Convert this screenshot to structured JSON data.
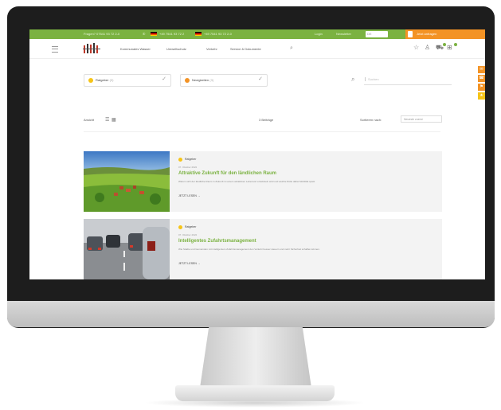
{
  "topbar": {
    "contact": "Fragen? 07541 93 72 2-0",
    "phone_de": "+49 7541 93 72 2",
    "phone_alt": "+49 7541 93 72 2-0",
    "link1": "Login",
    "link2": "Newsletter",
    "box_label": "DE",
    "orange_label": "Jetzt anfragen"
  },
  "nav": {
    "items": [
      "Kommunales Wasser",
      "Umweltschutz",
      "Verkehr",
      "Service & Dokumente"
    ],
    "icons": [
      "star-icon",
      "user-icon",
      "cart-icon",
      "bag-icon"
    ]
  },
  "filters": [
    {
      "label": "Ratgeber",
      "count": "(3)",
      "color": "#f6c417"
    },
    {
      "label": "Neuigkeiten",
      "count": "(3)",
      "color": "#f39325"
    }
  ],
  "search": {
    "placeholder": "Suchen"
  },
  "view": {
    "label": "Ansicht",
    "results": "3 Beiträge",
    "sort_label": "Sortieren nach:",
    "sort_value": "Neueste zuerst"
  },
  "articles": [
    {
      "category": "Ratgeber",
      "date": "07. Oktober 2022",
      "title": "Attraktive Zukunft für den ländlichen Raum",
      "description": "Warum sich der ländliche Raum in Zukunft zu einem attraktiven Lebensort entwickeln wird und welche Rolle dabei Mobilität spielt.",
      "more": "JETZT LESEN"
    },
    {
      "category": "Ratgeber",
      "date": "07. Oktober 2022",
      "title": "Intelligentes Zufahrtsmanagement",
      "description": "Wie Städte und Gemeinden mit intelligentem Zufahrtsmanagement den Verkehr besser steuern und mehr Sicherheit schaffen können.",
      "more": "JETZT LESEN"
    }
  ],
  "side_tabs": [
    "✉",
    "☎",
    "⚑",
    "★"
  ],
  "colors": {
    "green": "#7bb241",
    "orange": "#f39325",
    "yellow": "#f6c417"
  }
}
